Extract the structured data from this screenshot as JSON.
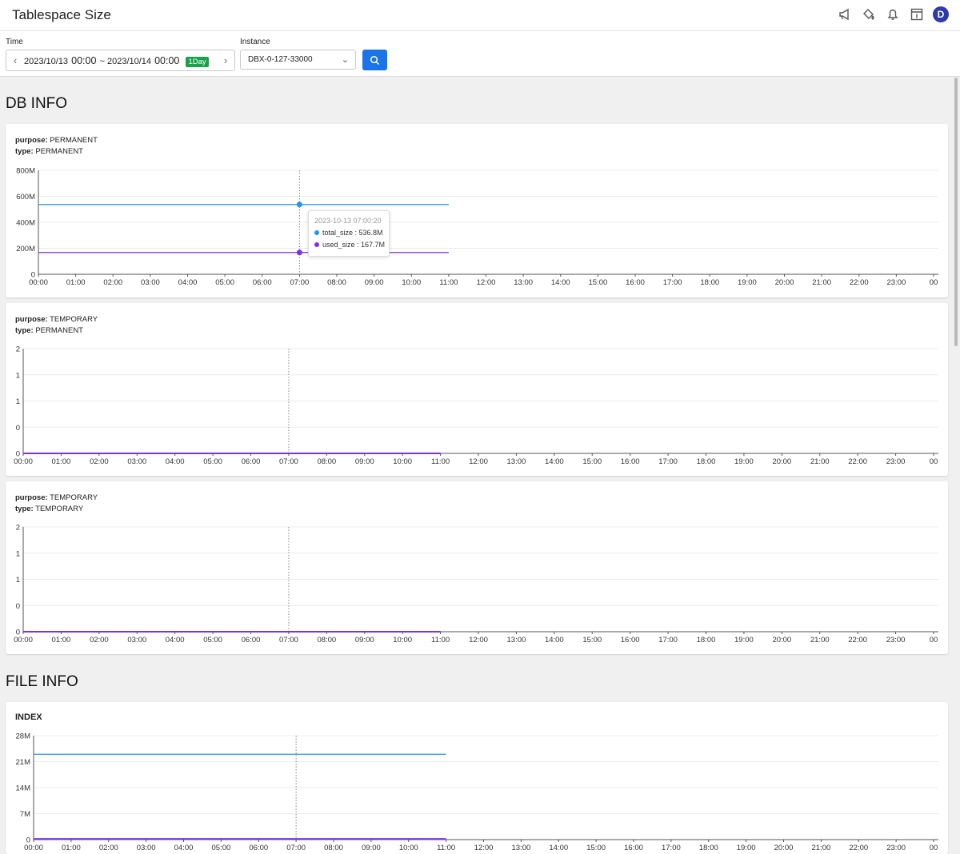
{
  "header": {
    "title": "Tablespace Size",
    "icons": [
      "megaphone-icon",
      "paint-bucket-icon",
      "bell-icon",
      "info-panel-icon"
    ],
    "avatar_initial": "D"
  },
  "filters": {
    "time_label": "Time",
    "start_date": "2023/10/13",
    "start_time": "00:00",
    "separator": "~",
    "end_date": "2023/10/14",
    "end_time": "00:00",
    "range_badge": "1Day",
    "instance_label": "Instance",
    "instance_value": "DBX-0-127-33000"
  },
  "sections": {
    "db_info": "DB INFO",
    "file_info": "FILE INFO"
  },
  "colors": {
    "total_size": "#2196f3",
    "used_size": "#7e2ff0",
    "accent": "#1a73e8",
    "badge": "#19a24b"
  },
  "charts": [
    {
      "purpose_label": "purpose:",
      "purpose": "PERMANENT",
      "type_label": "type:",
      "type": "PERMANENT",
      "y_ticks": [
        "800M",
        "600M",
        "400M",
        "200M",
        "0"
      ]
    },
    {
      "purpose_label": "purpose:",
      "purpose": "TEMPORARY",
      "type_label": "type:",
      "type": "PERMANENT",
      "y_ticks": [
        "2",
        "1",
        "1",
        "0",
        "0"
      ]
    },
    {
      "purpose_label": "purpose:",
      "purpose": "TEMPORARY",
      "type_label": "type:",
      "type": "TEMPORARY",
      "y_ticks": [
        "2",
        "1",
        "1",
        "0",
        "0"
      ]
    },
    {
      "heading": "INDEX",
      "y_ticks": [
        "28M",
        "21M",
        "14M",
        "7M",
        "0"
      ]
    }
  ],
  "x_ticks": [
    "00:00",
    "01:00",
    "02:00",
    "03:00",
    "04:00",
    "05:00",
    "06:00",
    "07:00",
    "08:00",
    "09:00",
    "10:00",
    "11:00",
    "12:00",
    "13:00",
    "14:00",
    "15:00",
    "16:00",
    "17:00",
    "18:00",
    "19:00",
    "20:00",
    "21:00",
    "22:00",
    "23:00",
    "00"
  ],
  "tooltip": {
    "time": "2023-10-13 07:00:20",
    "total_label": "total_size : 536.8M",
    "used_label": "used_size : 167.7M"
  },
  "chart_data": [
    {
      "type": "line",
      "xlim": [
        "00:00",
        "24:00"
      ],
      "ylim": [
        0,
        800
      ],
      "y_unit": "M",
      "series": [
        {
          "name": "total_size",
          "x": [
            "00:00",
            "11:00"
          ],
          "values": [
            536.8,
            536.8
          ]
        },
        {
          "name": "used_size",
          "x": [
            "00:00",
            "11:00"
          ],
          "values": [
            167.7,
            167.7
          ]
        }
      ],
      "hover_x": "07:00"
    },
    {
      "type": "line",
      "xlim": [
        "00:00",
        "24:00"
      ],
      "ylim": [
        0,
        2
      ],
      "series": [
        {
          "name": "total_size",
          "x": [
            "00:00",
            "11:00"
          ],
          "values": [
            0,
            0
          ]
        },
        {
          "name": "used_size",
          "x": [
            "00:00",
            "11:00"
          ],
          "values": [
            0,
            0
          ]
        }
      ],
      "hover_x": "07:00"
    },
    {
      "type": "line",
      "xlim": [
        "00:00",
        "24:00"
      ],
      "ylim": [
        0,
        2
      ],
      "series": [
        {
          "name": "total_size",
          "x": [
            "00:00",
            "11:00"
          ],
          "values": [
            0,
            0
          ]
        },
        {
          "name": "used_size",
          "x": [
            "00:00",
            "11:00"
          ],
          "values": [
            0,
            0
          ]
        }
      ],
      "hover_x": "07:00"
    },
    {
      "type": "line",
      "xlim": [
        "00:00",
        "24:00"
      ],
      "ylim": [
        0,
        28
      ],
      "y_unit": "M",
      "series": [
        {
          "name": "total_size",
          "x": [
            "00:00",
            "11:00"
          ],
          "values": [
            23,
            23
          ]
        },
        {
          "name": "used_size",
          "x": [
            "00:00",
            "11:00"
          ],
          "values": [
            0.2,
            0.2
          ]
        }
      ],
      "hover_x": "07:00"
    }
  ]
}
